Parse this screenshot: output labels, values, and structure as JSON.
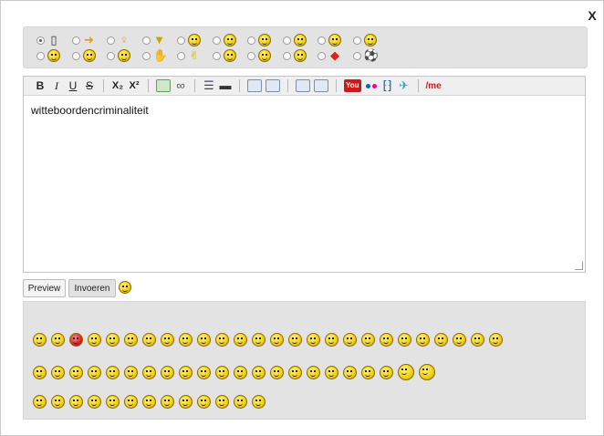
{
  "dialog": {
    "close_label": "X"
  },
  "icon_radios": {
    "row1": [
      "clock-icon",
      "arrow-icon",
      "lightbulb-icon",
      "triangle-icon",
      "smiley",
      "smiley",
      "smiley",
      "smiley",
      "smiley",
      "smiley"
    ],
    "row2": [
      "smiley",
      "smiley",
      "smiley",
      "thumb-icon",
      "smiley",
      "smiley",
      "smiley",
      "smiley",
      "superman-icon",
      "soccer-ball-icon"
    ],
    "selected_index": 0
  },
  "toolbar": {
    "bold": "B",
    "italic": "I",
    "underline": "U",
    "strike": "S",
    "subscript": "X₂",
    "superscript": "X²",
    "youtube": "You",
    "me": "/me"
  },
  "editor": {
    "text": "witteboordencriminaliteit"
  },
  "buttons": {
    "preview": "Preview",
    "submit": "Invoeren"
  },
  "smiley_panel": {
    "row1_count": 26,
    "row2_count": 22,
    "row3_count": 13
  }
}
